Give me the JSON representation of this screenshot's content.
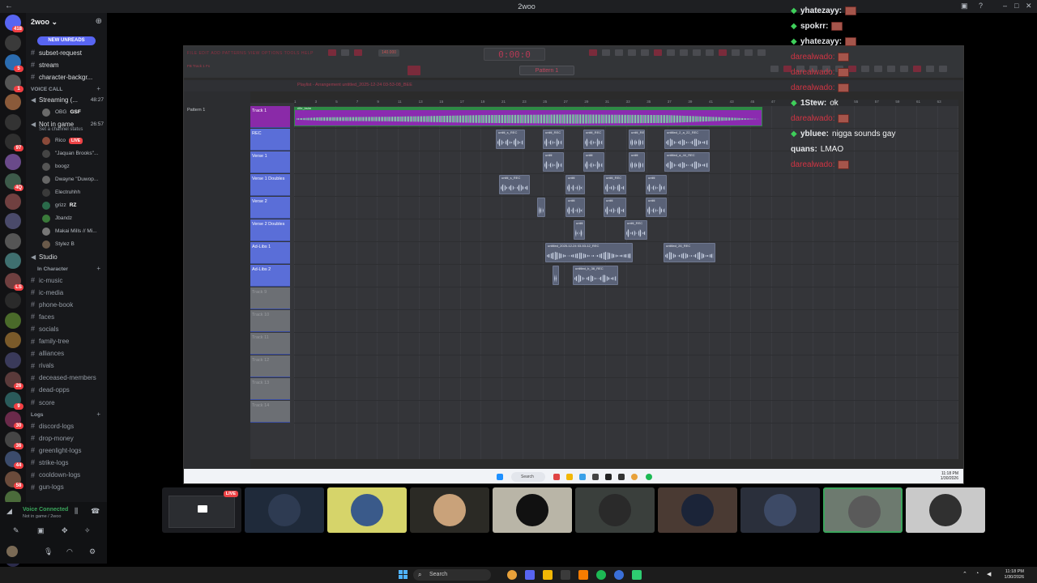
{
  "window": {
    "title": "2woo"
  },
  "server": {
    "name": "2woo",
    "new_unreads": "NEW UNREADS",
    "rail_badges": [
      "418",
      "5",
      "1",
      "97",
      "4Q",
      "LS",
      "26",
      "9",
      "30",
      "36",
      "44",
      "58",
      "92",
      "NEW"
    ]
  },
  "channels_top": [
    {
      "name": "subset-request"
    },
    {
      "name": "stream"
    },
    {
      "name": "character-backgr..."
    }
  ],
  "voice_call": {
    "category": "VOICE CALL",
    "streaming": {
      "name": "Streaming (...",
      "time": "48:27"
    },
    "streaming_members": [
      {
        "name": "OBG",
        "tag": "GSF"
      }
    ],
    "not_in_game": {
      "name": "Not in game",
      "time": "26:57",
      "status": "Set a channel status"
    },
    "members": [
      {
        "name": "Rico",
        "live": "LIVE"
      },
      {
        "name": "\"Jaquan Brooks\"..."
      },
      {
        "name": "boogz"
      },
      {
        "name": "Dwayne \"Duwop..."
      },
      {
        "name": "Electruhhh"
      },
      {
        "name": "grizz",
        "tag": "RZ"
      },
      {
        "name": "Jbandz"
      },
      {
        "name": "Makai Mills // Mi..."
      },
      {
        "name": "Stylez B"
      }
    ],
    "studio": {
      "name": "Studio"
    }
  },
  "in_character": {
    "category": "In Character",
    "channels": [
      "ic-music",
      "ic-media",
      "phone-book",
      "faces",
      "socials",
      "family-tree",
      "alliances",
      "rivals",
      "deceased-members",
      "dead-opps",
      "score"
    ]
  },
  "logs": {
    "category": "Logs",
    "channels": [
      "discord-logs",
      "drop-money",
      "greenlight-logs",
      "strike-logs",
      "cooldown-logs",
      "gun-logs"
    ]
  },
  "voice_panel": {
    "status": "Voice Connected",
    "sub": "Not in game / 2woo"
  },
  "daw": {
    "led_time": "0:00:0",
    "bpm": "140.000",
    "pattern": "Pattern 1",
    "menu": "FILE EDIT ADD PATTERNS VIEW OPTIONS TOOLS HELP",
    "hint": "FB Track 1 Fx",
    "playlist_title": "Playlist - Arrangement  untitled_2025-12-24 03-53-08_BEE",
    "pattern_item": "Pattern 1",
    "ruler": [
      "1",
      "3",
      "5",
      "7",
      "9",
      "11",
      "13",
      "15",
      "17",
      "19",
      "21",
      "23",
      "25",
      "27",
      "29",
      "31",
      "33",
      "35",
      "37",
      "39",
      "41",
      "43",
      "45",
      "47",
      "49",
      "51",
      "53",
      "55",
      "57",
      "59",
      "61",
      "63"
    ],
    "tracks": [
      "Track 1",
      "REC",
      "Verse 1",
      "Verse 1 Doubles",
      "Verse 2",
      "Verse 2 Doubles",
      "Ad-Libs 1",
      "Ad-Libs 2",
      "Track 9",
      "Track 10",
      "Track 11",
      "Track 12",
      "Track 13",
      "Track 14"
    ],
    "beat_clip": "rifle_bsim",
    "clips": [
      {
        "track": 1,
        "label": "untitl_s_REC"
      },
      {
        "track": 1,
        "label": "untitl_REC"
      },
      {
        "track": 1,
        "label": "untitl_REC"
      },
      {
        "track": 1,
        "label": "untitl_REC"
      },
      {
        "track": 1,
        "label": "untitled_2_a_22_REC"
      },
      {
        "track": 2,
        "label": "untitl"
      },
      {
        "track": 2,
        "label": "untitl"
      },
      {
        "track": 2,
        "label": "untitl"
      },
      {
        "track": 2,
        "label": "untitl"
      },
      {
        "track": 2,
        "label": "untitled_a_44_REC"
      },
      {
        "track": 3,
        "label": "untitl_s_REC"
      },
      {
        "track": 3,
        "label": "untitl"
      },
      {
        "track": 3,
        "label": "untitl_REC"
      },
      {
        "track": 3,
        "label": "untitl"
      },
      {
        "track": 4,
        "label": ""
      },
      {
        "track": 4,
        "label": "untitl"
      },
      {
        "track": 4,
        "label": "untitl"
      },
      {
        "track": 4,
        "label": "untitl"
      },
      {
        "track": 5,
        "label": "untitl"
      },
      {
        "track": 5,
        "label": "untitl_REC"
      },
      {
        "track": 6,
        "label": "untitled_2025-12-24 03-53-12_REC"
      },
      {
        "track": 6,
        "label": "untitled_26_REC"
      },
      {
        "track": 7,
        "label": ""
      },
      {
        "track": 7,
        "label": "untitled_b_38_REC"
      }
    ],
    "inner_taskbar": {
      "search": "Search",
      "time": "11:18 PM",
      "date": "1/30/2026"
    }
  },
  "chat": [
    {
      "user": "yhatezayy:",
      "msg": "",
      "emote": true,
      "badge": true,
      "red": false
    },
    {
      "user": "spokrr:",
      "msg": "",
      "emote": true,
      "badge": true,
      "red": false
    },
    {
      "user": "yhatezayy:",
      "msg": "",
      "emote": true,
      "badge": true,
      "red": false
    },
    {
      "user": "darealwado:",
      "msg": "",
      "emote": true,
      "badge": false,
      "red": true
    },
    {
      "user": "darealwado:",
      "msg": "",
      "emote": true,
      "badge": false,
      "red": true
    },
    {
      "user": "darealwado:",
      "msg": "",
      "emote": true,
      "badge": false,
      "red": true
    },
    {
      "user": "1Stew:",
      "msg": "ok",
      "emote": false,
      "badge": true,
      "red": false
    },
    {
      "user": "darealwado:",
      "msg": "",
      "emote": true,
      "badge": false,
      "red": true
    },
    {
      "user": "ybluee:",
      "msg": "nigga sounds gay",
      "emote": false,
      "badge": true,
      "red": false
    },
    {
      "user": "quans:",
      "msg": "LMAO",
      "emote": false,
      "badge": false,
      "red": false
    },
    {
      "user": "darealwado:",
      "msg": "",
      "emote": true,
      "badge": false,
      "red": true
    }
  ],
  "tiles": [
    {
      "name": "screen-share",
      "live": "LIVE",
      "color": "#1b1c20"
    },
    {
      "name": "participant-2",
      "color": "#1f2a3a"
    },
    {
      "name": "participant-3",
      "color": "#d6d46a"
    },
    {
      "name": "participant-4",
      "color": "#2b2a25"
    },
    {
      "name": "participant-5",
      "color": "#b9b5a7"
    },
    {
      "name": "participant-6",
      "color": "#3a3f3c"
    },
    {
      "name": "participant-7",
      "color": "#4a3a33"
    },
    {
      "name": "participant-8",
      "color": "#2a2f3b"
    },
    {
      "name": "participant-9",
      "color": "#6d7a6f"
    },
    {
      "name": "participant-10",
      "color": "#c9c9c9"
    }
  ],
  "taskbar": {
    "search": "Search",
    "time": "11:18 PM",
    "date": "1/30/2026"
  },
  "colors": {
    "accent": "#5865f2",
    "live": "#ed4245",
    "online": "#3ba55c",
    "fl_red": "#b33a55"
  }
}
